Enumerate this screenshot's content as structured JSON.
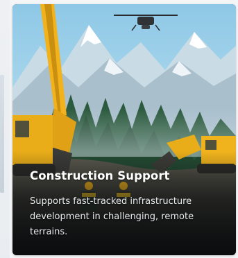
{
  "card": {
    "title": "Construction Support",
    "description": "Supports fast-tracked infrastructure development in challenging, remote terrains."
  },
  "colors": {
    "sky": "#a9d8ec",
    "mountain": "#dfe8ef",
    "forest": "#2f5a3c",
    "machinery": "#f2b21c",
    "title_text": "#ffffff"
  },
  "icons": [
    "drone-icon",
    "excavator-icon",
    "worker-icon"
  ]
}
